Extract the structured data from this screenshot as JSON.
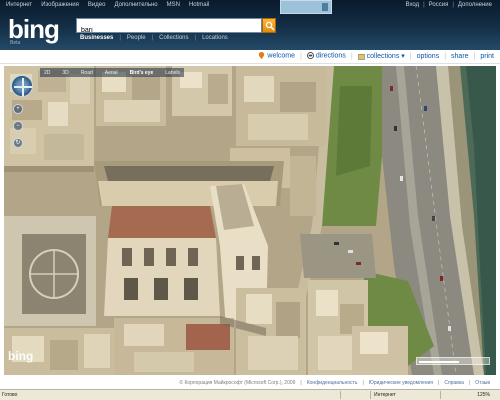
{
  "header": {
    "nav": [
      "Интернет",
      "Изображения",
      "Видео",
      "Дополнительно",
      "MSN",
      "Hotmail"
    ],
    "right_links": [
      "Вход",
      "Россия",
      "Дополнение"
    ],
    "logo": "bing",
    "logo_sub": "Beta",
    "search": {
      "value": "bari"
    },
    "scopes": [
      "Businesses",
      "People",
      "Collections",
      "Locations"
    ]
  },
  "toolbar": {
    "items": [
      {
        "label": "welcome",
        "icon": "pin-icon"
      },
      {
        "label": "directions",
        "icon": "car-icon"
      },
      {
        "label": "collections",
        "icon": "folder-icon"
      },
      {
        "label": "options"
      },
      {
        "label": "share"
      },
      {
        "label": "print"
      }
    ]
  },
  "map": {
    "modes": [
      "2D",
      "3D",
      "Road",
      "Aerial",
      "Bird's eye",
      "Labels"
    ],
    "active_mode": "Bird's eye",
    "watermark": "bing"
  },
  "footer": {
    "copyright": "© Корпорация Майкрософт (Microsoft Corp.), 2009",
    "links": [
      "Конфиденциальность",
      "Юридические уведомления",
      "Справка",
      "Отзыв"
    ]
  },
  "statusbar": {
    "left": "Готово",
    "zone": "Интернет",
    "zoom": "125%"
  },
  "colors": {
    "header_bg": "#142f47",
    "link": "#0b56a5",
    "search_button": "#e38a0d"
  }
}
